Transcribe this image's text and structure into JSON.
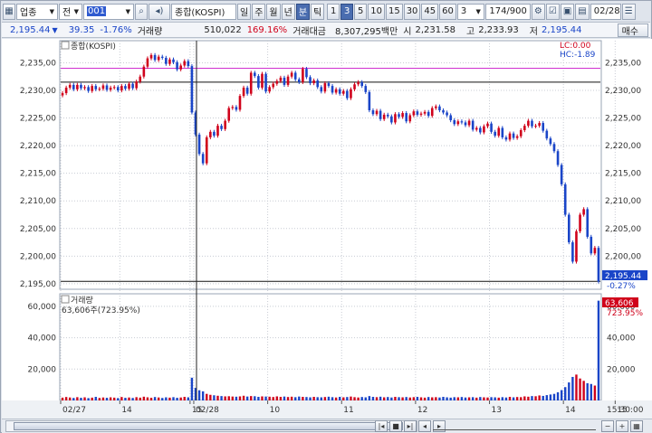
{
  "toolbar": {
    "market": "업종",
    "jeon": "전",
    "code": "001",
    "name": "종합(KOSPI)",
    "periods": [
      "일",
      "주",
      "월",
      "년",
      "분",
      "틱"
    ],
    "active_period": "분",
    "minutes": [
      "1",
      "3",
      "5",
      "10",
      "15",
      "30",
      "45",
      "60"
    ],
    "active_minute": "3",
    "interval_value": "3",
    "count": "174/900",
    "time": "02/28"
  },
  "info": {
    "price": "2,195.44",
    "change_arrow": "▼",
    "change": "39.35",
    "change_pct": "-1.76%",
    "volume_label": "거래량",
    "volume": "510,022",
    "volume_pct": "169.16%",
    "amount_label": "거래대금",
    "amount": "8,307,295백만",
    "open_label": "시",
    "open": "2,231.58",
    "high_label": "고",
    "high": "2,233.93",
    "low_label": "저",
    "low": "2,195.44",
    "order_button": "매수"
  },
  "chart_data": [
    {
      "type": "candlestick",
      "title": "종합(KOSPI)",
      "ylim": [
        2194,
        2239
      ],
      "yticks": [
        "2,235,00",
        "2,230,00",
        "2,225,00",
        "2,220,00",
        "2,215,00",
        "2,210,00",
        "2,205,00",
        "2,200,00",
        "2,195,00"
      ],
      "right_yticks": [
        "2,235,00",
        "2,230,00",
        "2,225,00",
        "2,220,00",
        "2,215,00",
        "2,210,00",
        "2,205,00",
        "2,200,00"
      ],
      "x_labels": [
        "02/27",
        "14",
        "15",
        "02/28",
        "10",
        "11",
        "12",
        "13",
        "14",
        "15"
      ],
      "lc": "LC:0.00",
      "hc": "HC:-1.89",
      "last_price_label": "2,195.44",
      "last_pct_label": "-0.27%",
      "hlines": [
        2234,
        2231.5,
        2195.44
      ],
      "close_series": [
        2229.5,
        2230.5,
        2231,
        2230.2,
        2231,
        2230.4,
        2230.6,
        2229.9,
        2230.8,
        2230.2,
        2230.3,
        2230.9,
        2230.1,
        2230.5,
        2230.6,
        2230,
        2230.8,
        2230.3,
        2231.2,
        2230.4,
        2231.6,
        2232.5,
        2234.3,
        2235.8,
        2236.4,
        2235.5,
        2236.1,
        2235.9,
        2234.8,
        2235.6,
        2235.1,
        2233.8,
        2234.5,
        2235.3,
        2234.4,
        2226,
        2222,
        2218.5,
        2216.8,
        2221.5,
        2222.5,
        2221.8,
        2223.6,
        2223,
        2224.5,
        2226.8,
        2227,
        2226.5,
        2229,
        2230.5,
        2229.4,
        2233.2,
        2232.6,
        2230.5,
        2233,
        2229.8,
        2230.6,
        2231.2,
        2231.7,
        2232.3,
        2231,
        2232.5,
        2233.2,
        2232,
        2231.5,
        2233.9,
        2232.4,
        2231.3,
        2231.8,
        2230.6,
        2229.8,
        2231.3,
        2230.8,
        2229.6,
        2230.2,
        2229.4,
        2229.9,
        2228.6,
        2230.2,
        2231.1,
        2231.5,
        2230.8,
        2229.7,
        2226.4,
        2225.7,
        2226.3,
        2224.8,
        2225.6,
        2225.3,
        2224.2,
        2225.7,
        2225.2,
        2225.9,
        2224.4,
        2225.5,
        2226.2,
        2225.6,
        2225.8,
        2226.1,
        2225.4,
        2226.8,
        2227.1,
        2226.4,
        2226,
        2225.5,
        2224.6,
        2223.9,
        2224.4,
        2224.2,
        2223.7,
        2224.5,
        2222.9,
        2223.2,
        2222.4,
        2223.5,
        2224,
        2222.5,
        2221.8,
        2223.2,
        2221.5,
        2221.1,
        2222.2,
        2221.4,
        2221.7,
        2222.8,
        2223.6,
        2224.5,
        2223.5,
        2223.6,
        2224.1,
        2222.7,
        2221.3,
        2220.3,
        2219,
        2216.5,
        2213,
        2207.5,
        2202.5,
        2199,
        2204.5,
        2207.5,
        2208.5,
        2203.5,
        2200.5,
        2201.5,
        2195.4
      ]
    },
    {
      "type": "bar",
      "title": "거래량",
      "value_label": "63,606주(723.95%)",
      "ylim": [
        0,
        68000
      ],
      "yticks": [
        "60,000",
        "40,000",
        "20,000"
      ],
      "right_yticks": [
        "60,000",
        "40,000",
        "20,000"
      ],
      "last_label": "63,606",
      "last_pct_label": "723.95%",
      "values": [
        1800,
        2200,
        1900,
        1600,
        2100,
        1700,
        2000,
        1500,
        1800,
        2300,
        1600,
        1900,
        1700,
        2000,
        1800,
        1500,
        2200,
        1700,
        1900,
        1600,
        2100,
        1800,
        2400,
        2000,
        1700,
        2200,
        1900,
        1600,
        2000,
        1800,
        2100,
        1700,
        1900,
        2300,
        2000,
        14500,
        8000,
        6500,
        5800,
        4200,
        3600,
        3300,
        3000,
        2800,
        2600,
        2700,
        2500,
        2400,
        2600,
        3000,
        2500,
        2800,
        2700,
        2300,
        2600,
        2500,
        2400,
        2200,
        2600,
        2300,
        2500,
        2200,
        2400,
        2100,
        2500,
        2300,
        2200,
        2000,
        2300,
        2100,
        2000,
        2200,
        2400,
        2100,
        1900,
        2300,
        2000,
        2200,
        2500,
        2100,
        1900,
        2200,
        2000,
        2800,
        2300,
        2100,
        2400,
        2000,
        2200,
        1900,
        2300,
        2100,
        2000,
        2200,
        1900,
        2100,
        2300,
        2000,
        1800,
        2200,
        2000,
        2100,
        1900,
        2300,
        2000,
        1800,
        2100,
        2000,
        2200,
        1900,
        2000,
        2100,
        1800,
        2200,
        2000,
        1900,
        2100,
        2000,
        1800,
        2100,
        1900,
        2300,
        2000,
        2200,
        2100,
        2600,
        2400,
        2800,
        2700,
        3200,
        2900,
        3400,
        3800,
        4200,
        5200,
        6600,
        8500,
        11500,
        15000,
        16500,
        14000,
        12500,
        11000,
        10500,
        9500,
        63606
      ]
    }
  ],
  "footer": {
    "time": "15:30:00"
  },
  "colors": {
    "up": "#d0021b",
    "down": "#1a45c8",
    "magenta": "#d030d0",
    "grid": "#c8ccd4"
  }
}
